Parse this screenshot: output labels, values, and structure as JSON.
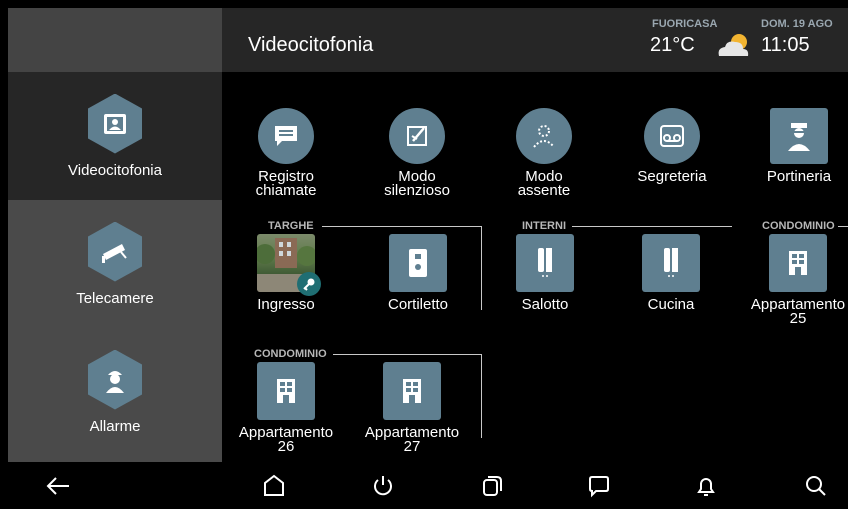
{
  "header": {
    "title": "Videocitofonia",
    "weather_label": "FUORICASA",
    "temperature": "21°C",
    "date": "DOM. 19 AGO",
    "time": "11:05"
  },
  "sidebar": {
    "items": [
      {
        "label": "Videocitofonia",
        "icon": "intercom-screen-icon"
      },
      {
        "label": "Telecamere",
        "icon": "camera-icon"
      },
      {
        "label": "Allarme",
        "icon": "guard-icon"
      }
    ]
  },
  "actions": [
    {
      "label": "Registro chiamate",
      "icon": "chat-icon"
    },
    {
      "label": "Modo silenzioso",
      "icon": "mute-icon"
    },
    {
      "label": "Modo assente",
      "icon": "away-icon"
    },
    {
      "label": "Segreteria",
      "icon": "voicemail-icon"
    },
    {
      "label": "Portineria",
      "icon": "concierge-icon"
    }
  ],
  "groups": {
    "targhe": {
      "title": "TARGHE",
      "items": [
        {
          "label": "Ingresso",
          "icon": "photo-key-icon"
        },
        {
          "label": "Cortiletto",
          "icon": "doorbell-icon"
        }
      ]
    },
    "interni": {
      "title": "INTERNI",
      "items": [
        {
          "label": "Salotto",
          "icon": "handset-icon"
        },
        {
          "label": "Cucina",
          "icon": "handset-icon"
        }
      ]
    },
    "condominio1": {
      "title": "CONDOMINIO",
      "items": [
        {
          "label": "Appartamento 25",
          "icon": "building-icon"
        }
      ]
    },
    "condominio2": {
      "title": "CONDOMINIO",
      "items": [
        {
          "label": "Appartamento 26",
          "icon": "building-icon"
        },
        {
          "label": "Appartamento 27",
          "icon": "building-icon"
        }
      ]
    }
  },
  "colors": {
    "tile_bg": "#5f7f90",
    "active_bg": "#262626",
    "sidebar_bg": "#4a4a4a"
  }
}
